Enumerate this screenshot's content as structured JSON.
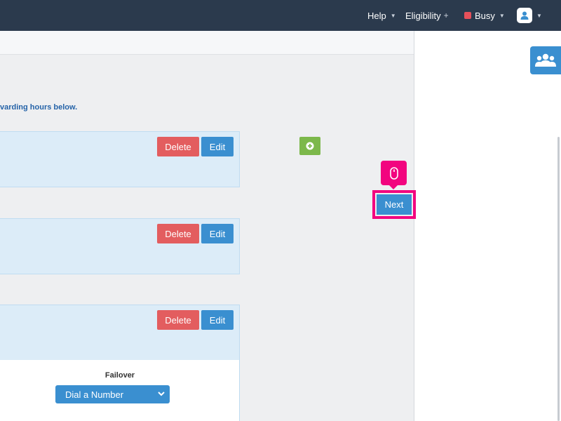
{
  "topbar": {
    "help_label": "Help",
    "eligibility_label": "Eligibility",
    "status_label": "Busy",
    "status_color": "#e6505a",
    "background_color": "#2b3a4d"
  },
  "instruction_text": "varding hours below.",
  "cards": [
    {
      "delete_label": "Delete",
      "edit_label": "Edit"
    },
    {
      "delete_label": "Delete",
      "edit_label": "Edit"
    },
    {
      "delete_label": "Delete",
      "edit_label": "Edit"
    }
  ],
  "failover": {
    "label": "Failover",
    "selected_option": "Dial a Number"
  },
  "next_label": "Next",
  "icons": {
    "add": "plus-circle-icon",
    "group": "users-group-icon",
    "avatar": "user-icon",
    "tooltip": "mouse-icon"
  },
  "colors": {
    "primary": "#3a8fd0",
    "danger": "#e35d5f",
    "success": "#7cb84b",
    "highlight": "#f2057f"
  }
}
